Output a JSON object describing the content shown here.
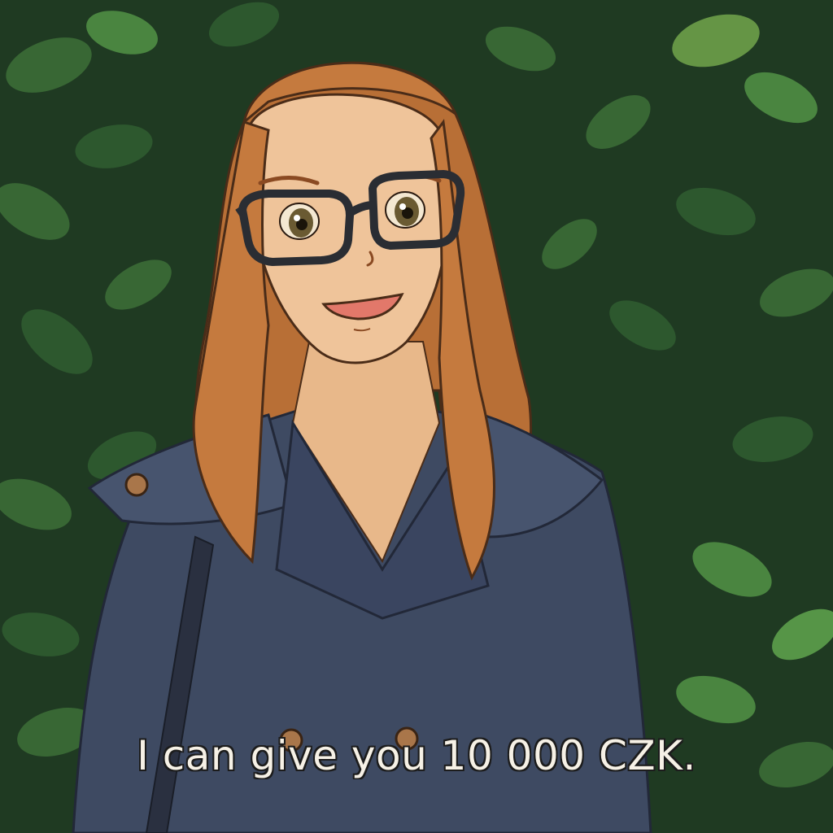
{
  "subtitle": {
    "text": "I can give you 10 000 CZK."
  },
  "palette": {
    "foliage_dark": "#1f3a22",
    "foliage_mid": "#2f5a30",
    "foliage_light": "#4d8a43",
    "hair": "#c57a3e",
    "skin": "#efc49a",
    "coat": "#3e4a62",
    "glasses": "#2a2d33",
    "button": "#a9764a"
  }
}
